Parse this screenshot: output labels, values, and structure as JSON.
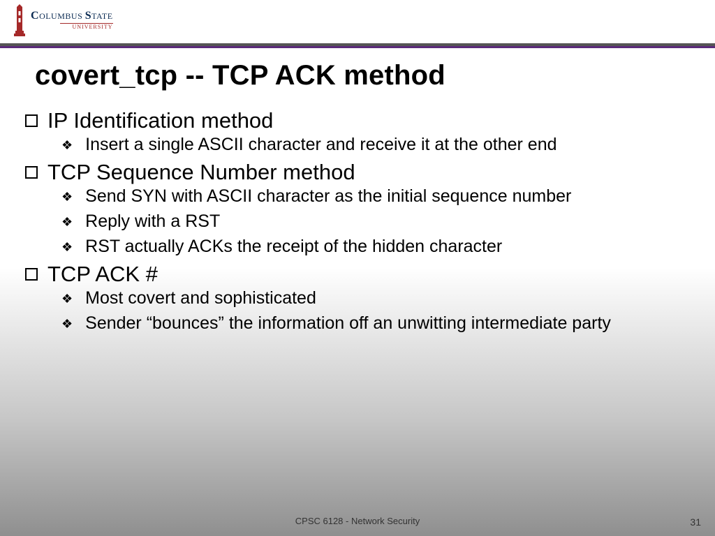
{
  "logo": {
    "line1_big1": "C",
    "line1_small1": "OLUMBUS ",
    "line1_big2": "S",
    "line1_small2": "TATE",
    "line2": "UNIVERSITY"
  },
  "title": "covert_tcp -- TCP ACK method",
  "sections": [
    {
      "heading": "IP Identification method",
      "items": [
        "Insert a single ASCII character and receive it at the other end"
      ]
    },
    {
      "heading": "TCP Sequence Number method",
      "items": [
        "Send SYN with ASCII character as the initial sequence number",
        "Reply with a RST",
        "RST actually ACKs the receipt of the hidden character"
      ]
    },
    {
      "heading": "TCP ACK #",
      "items": [
        "Most covert and sophisticated",
        "Sender “bounces” the information off an unwitting intermediate party"
      ]
    }
  ],
  "footer": "CPSC 6128 - Network Security",
  "page": "31"
}
